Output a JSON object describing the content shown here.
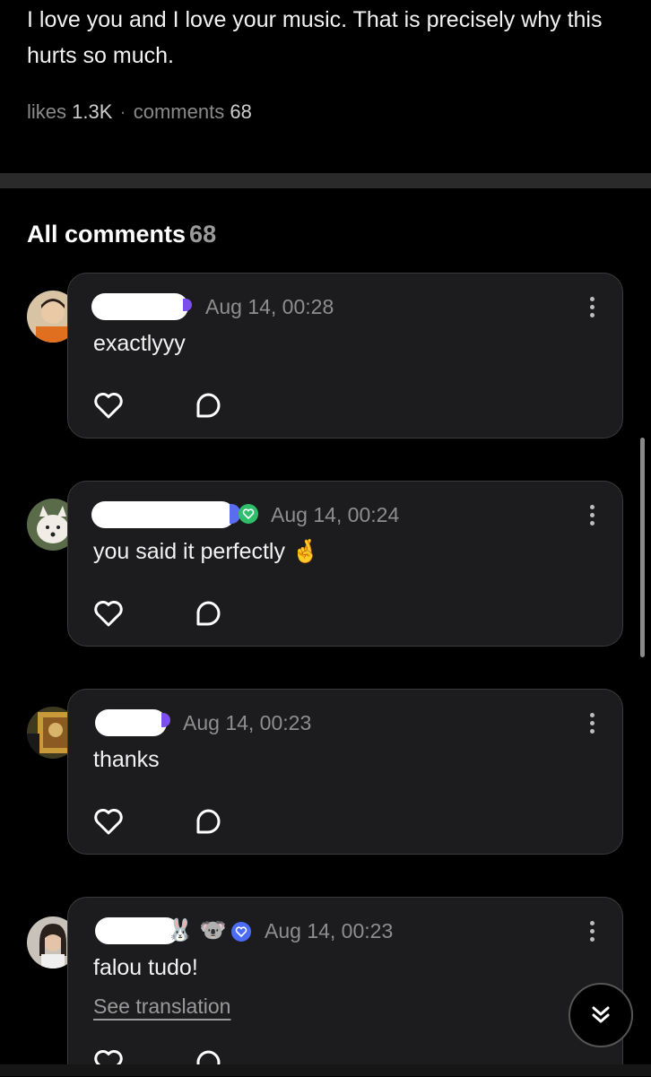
{
  "post": {
    "text": "I love you and I love your music. That is precisely why this hurts so much.",
    "likes_label": "likes",
    "likes_count": "1.3K",
    "separator": "·",
    "comments_label": "comments",
    "comments_count": "68"
  },
  "section": {
    "title": "All comments",
    "count": "68"
  },
  "comments": [
    {
      "date": "Aug 14, 00:28",
      "text": "exactlyyy",
      "avatar": "avatar-person-orange",
      "badge": "purple"
    },
    {
      "date": "Aug 14, 00:24",
      "text": "you said it perfectly",
      "emoji": "🤞",
      "avatar": "avatar-white-fox",
      "badge": "green-verified"
    },
    {
      "date": "Aug 14, 00:23",
      "text": "thanks",
      "avatar": "avatar-painting",
      "badge": "purple"
    },
    {
      "date": "Aug 14, 00:23",
      "text": "falou tudo!",
      "translate": "See translation",
      "avatar": "avatar-selfie",
      "badge": "blue-verified",
      "extra_emojis": [
        "🐰",
        "🐨"
      ]
    }
  ],
  "colors": {
    "background": "#000000",
    "card": "#1c1c1e",
    "muted": "#8e8e8e",
    "verified_green": "#2fbf6a",
    "verified_blue": "#4a6cf7"
  }
}
